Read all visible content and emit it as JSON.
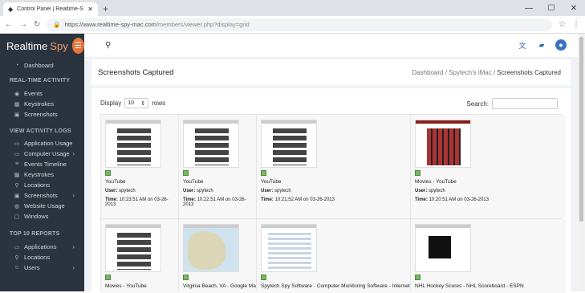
{
  "browser": {
    "tab_title": "Control Panel | Realtime-Spy",
    "new_tab": "+",
    "url_host": "https://www.realtime-spy-mac.com",
    "url_path": "/members/viewer.php?display=grid"
  },
  "brand": {
    "name1": "Realtime",
    "name2": "Spy"
  },
  "sidebar": {
    "dashboard": "Dashboard",
    "section_realtime": "REAL-TIME ACTIVITY",
    "realtime_items": [
      "Events",
      "Keystrokes",
      "Screenshots"
    ],
    "section_logs": "VIEW ACTIVITY LOGS",
    "log_items": [
      "Application Usage",
      "Computer Usage",
      "Events Timeline",
      "Keystrokes",
      "Locations",
      "Screenshots",
      "Website Usage",
      "Windows"
    ],
    "section_top10": "TOP 10 REPORTS",
    "top10_items": [
      "Applications",
      "Locations",
      "Users"
    ]
  },
  "page": {
    "title": "Screenshots Captured",
    "breadcrumb": [
      "Dashboard",
      "Spytech's iMac",
      "Screenshots Captured"
    ]
  },
  "controls": {
    "display_label": "Display",
    "display_value": "10",
    "rows_label": "rows",
    "search_label": "Search:"
  },
  "screenshots": [
    {
      "caption": "YouTube",
      "user_label": "User:",
      "user": "spytech",
      "time_label": "Time:",
      "time": "10:23:51 AM on 03-26-2013"
    },
    {
      "caption": "YouTube",
      "user_label": "User:",
      "user": "spytech",
      "time_label": "Time:",
      "time": "10:22:51 AM on 03-26-2013"
    },
    {
      "caption": "YouTube",
      "user_label": "User:",
      "user": "spytech",
      "time_label": "Time:",
      "time": "10:21:52 AM on 03-26-2013"
    },
    {
      "caption": "Movies - YouTube",
      "user_label": "User:",
      "user": "spytech",
      "time_label": "Time:",
      "time": "10:20:51 AM on 03-26-2013"
    },
    {
      "caption": "Movies - YouTube"
    },
    {
      "caption": "Virginia Beach, VA - Google Maps"
    },
    {
      "caption": "Spytech Spy Software - Computer Monitoring Software - Internet Recording"
    },
    {
      "caption": "NHL Hockey Scores - NHL Scoreboard - ESPN"
    }
  ],
  "colors": {
    "sidebar_bg": "#2b333e",
    "accent": "#e8743b"
  }
}
